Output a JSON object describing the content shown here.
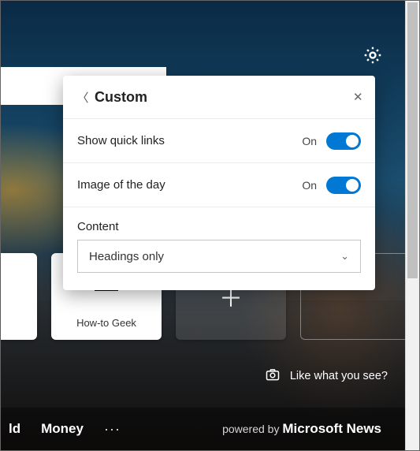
{
  "colors": {
    "accent": "#0078d4"
  },
  "gear": {
    "icon": "gear-icon"
  },
  "popover": {
    "title": "Custom",
    "back_icon": "chevron-left-icon",
    "close_icon": "close-icon",
    "rows": [
      {
        "label": "Show quick links",
        "state": "On",
        "on": true
      },
      {
        "label": "Image of the day",
        "state": "On",
        "on": true
      }
    ],
    "content_section": {
      "label": "Content",
      "selected": "Headings only",
      "chevron_icon": "chevron-down-icon"
    }
  },
  "tiles": {
    "items": [
      {
        "kind": "site",
        "caption": "How-to Geek"
      },
      {
        "kind": "add"
      },
      {
        "kind": "ghost"
      }
    ]
  },
  "like_bar": {
    "icon": "camera-icon",
    "text": "Like what you see?"
  },
  "navbar": {
    "items": [
      "ld",
      "Money"
    ],
    "more_icon": "more-icon",
    "powered_prefix": "powered by ",
    "powered_brand": "Microsoft News"
  }
}
